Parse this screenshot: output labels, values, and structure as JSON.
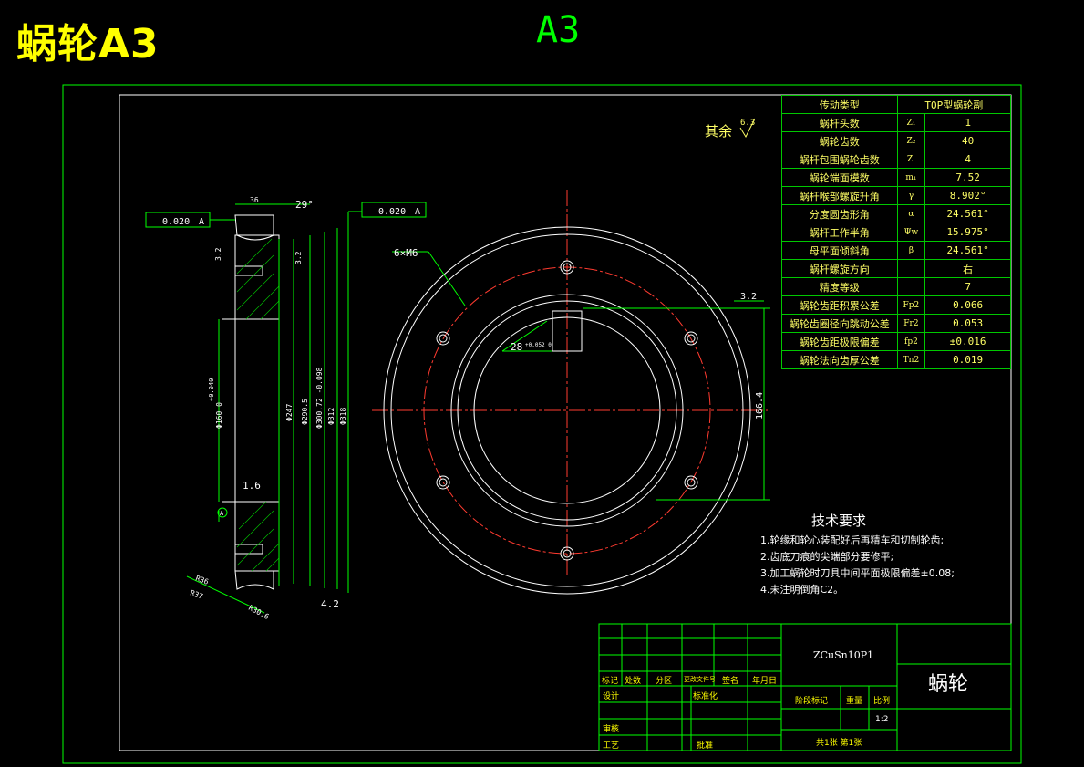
{
  "header": {
    "part_title": "蜗轮A3",
    "sheet_size": "A3"
  },
  "surface_note": {
    "label": "其余",
    "value": "6.3"
  },
  "section_view": {
    "tol_left": "0.020",
    "tol_left_ref": "A",
    "tol_right": "0.020",
    "tol_right_ref": "A",
    "dim_width": "36",
    "dim_angle": "29°",
    "dim_d1": "Φ160 0",
    "dim_d1_tol": "+0.040",
    "dim_d2": "Φ247",
    "dim_d3": "Φ290.5",
    "dim_d4": "Φ300.72 -0.098",
    "dim_d5": "Φ312",
    "dim_d6": "Φ318",
    "dim_rough_1": "1.6",
    "dim_r1": "R36",
    "dim_r2": "R37",
    "dim_r3": "R30.6",
    "datum": "A",
    "dim_bottom": "4.2",
    "rough_side_1": "3.2",
    "rough_side_2": "3.2"
  },
  "front_view": {
    "hole_note": "6×M6",
    "keyway_width": "28",
    "keyway_tol": "+0.052 0",
    "dim_height": "166.4",
    "rough_key": "3.2"
  },
  "param_table": {
    "rows": [
      {
        "name": "传动类型",
        "sym": "",
        "val": "TOP型蜗轮副"
      },
      {
        "name": "蜗杆头数",
        "sym": "Z₁",
        "val": "1"
      },
      {
        "name": "蜗轮齿数",
        "sym": "Z₂",
        "val": "40"
      },
      {
        "name": "蜗杆包围蜗轮齿数",
        "sym": "Z'",
        "val": "4"
      },
      {
        "name": "蜗轮端面模数",
        "sym": "m₁",
        "val": "7.52"
      },
      {
        "name": "蜗杆喉部螺旋升角",
        "sym": "γ",
        "val": "8.902°"
      },
      {
        "name": "分度圆齿形角",
        "sym": "α",
        "val": "24.561°"
      },
      {
        "name": "蜗杆工作半角",
        "sym": "Ψw",
        "val": "15.975°"
      },
      {
        "name": "母平面倾斜角",
        "sym": "β",
        "val": "24.561°"
      },
      {
        "name": "蜗杆螺旋方向",
        "sym": "",
        "val": "右"
      },
      {
        "name": "精度等级",
        "sym": "",
        "val": "7"
      },
      {
        "name": "蜗轮齿距积累公差",
        "sym": "Fp2",
        "val": "0.066"
      },
      {
        "name": "蜗轮齿圈径向跳动公差",
        "sym": "Fr2",
        "val": "0.053"
      },
      {
        "name": "蜗轮齿距极限偏差",
        "sym": "fp2",
        "val": "±0.016"
      },
      {
        "name": "蜗轮法向齿厚公差",
        "sym": "Tn2",
        "val": "0.019"
      }
    ]
  },
  "requirements": {
    "title": "技术要求",
    "items": [
      "1.轮缘和轮心装配好后再精车和切制轮齿;",
      "2.齿底刀痕的尖端部分要修平;",
      "3.加工蜗轮时刀具中间平面极限偏差±0.08;",
      "4.未注明倒角C2。"
    ]
  },
  "title_block": {
    "material": "ZCuSn10P1",
    "part_name": "蜗轮",
    "labels": [
      "标记",
      "处数",
      "分区",
      "更改文件号",
      "签名",
      "年月日",
      "设计",
      "标准化",
      "审核",
      "工艺",
      "批准",
      "阶段标记",
      "重量",
      "比例"
    ],
    "scale": "1:2",
    "sheet_info": "共1张 第1张"
  },
  "colors": {
    "frame": "#00ff00",
    "line": "#ffffff",
    "center": "#ff3b30",
    "text": "#ffff00"
  }
}
